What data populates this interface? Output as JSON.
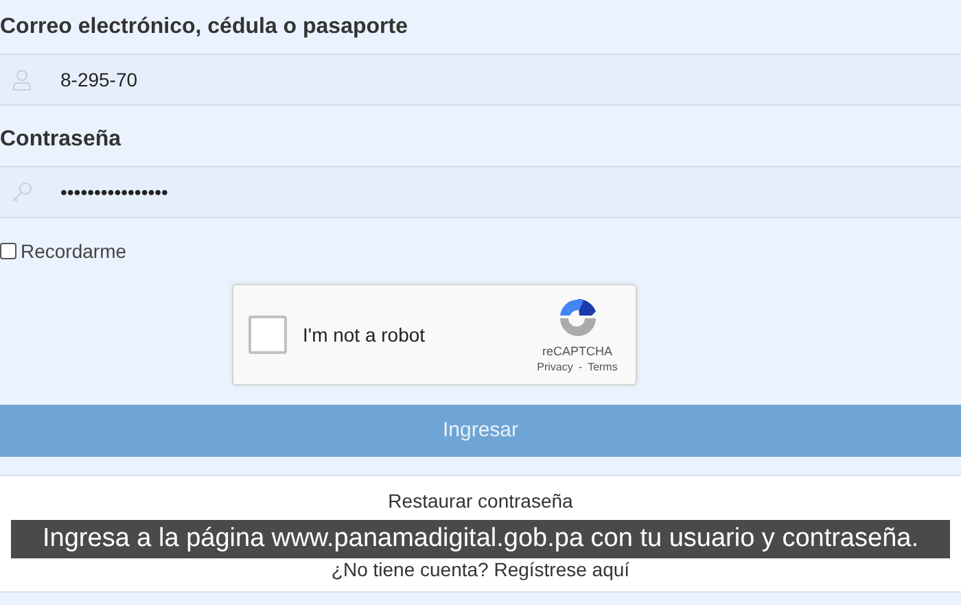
{
  "login_form": {
    "fields": [
      {
        "kind": "user",
        "label": "Correo electrónico, cédula o pasaporte",
        "value": "8-295-70"
      },
      {
        "kind": "password",
        "label": "Contraseña",
        "value": "••••••••••••••••"
      }
    ],
    "remember": {
      "label": "Recordarme",
      "checked": false
    },
    "captcha": {
      "label": "I'm not a robot",
      "checked": false,
      "brand": "reCAPTCHA",
      "privacy": "Privacy",
      "separator": "-",
      "terms": "Terms"
    },
    "submit": {
      "label": "Ingresar"
    },
    "links": [
      "Restaurar contraseña",
      "¿No tiene cuenta? Regístrese aquí"
    ]
  },
  "caption": {
    "text": "Ingresa a la página www.panamadigital.gob.pa con tu usuario y contraseña."
  }
}
